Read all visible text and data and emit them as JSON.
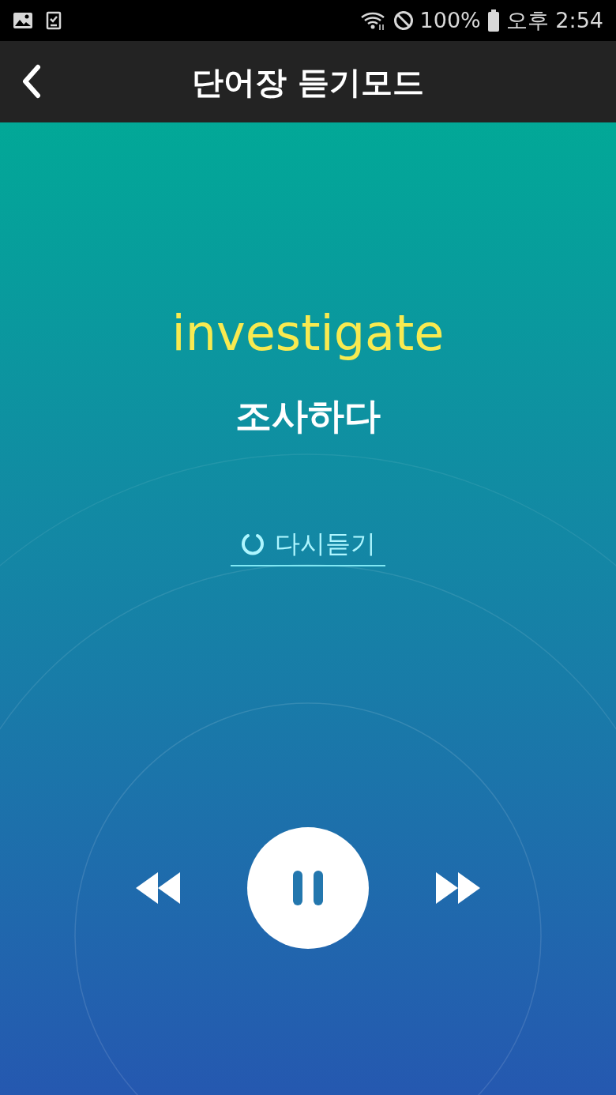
{
  "status_bar": {
    "battery": "100%",
    "time": "오후 2:54"
  },
  "header": {
    "title": "단어장 듣기모드"
  },
  "card": {
    "word": "investigate",
    "meaning": "조사하다"
  },
  "replay_button": {
    "label": "다시듣기"
  },
  "player": {
    "playing": true
  }
}
